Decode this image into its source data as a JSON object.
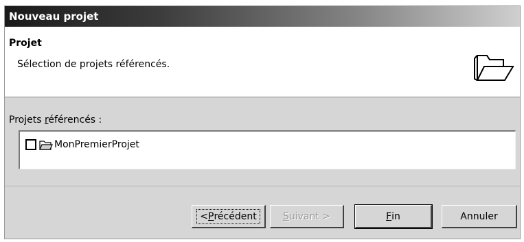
{
  "window": {
    "title": "Nouveau projet"
  },
  "banner": {
    "title": "Projet",
    "description": "Sélection de projets référencés.",
    "icon": "open-folder-icon"
  },
  "referenced": {
    "label_pre": "Projets ",
    "label_mnemonic": "r",
    "label_post": "éférencés :",
    "items": [
      {
        "label": "MonPremierProjet",
        "checked": false,
        "icon": "project-folder-icon"
      }
    ]
  },
  "buttons": {
    "back": {
      "pre": "< ",
      "mnemonic": "P",
      "post": "récédent",
      "enabled": true
    },
    "next": {
      "pre": "",
      "mnemonic": "S",
      "post": "uivant >",
      "enabled": false
    },
    "finish": {
      "pre": "",
      "mnemonic": "F",
      "post": "in",
      "enabled": true
    },
    "cancel": {
      "label": "Annuler",
      "enabled": true
    }
  }
}
